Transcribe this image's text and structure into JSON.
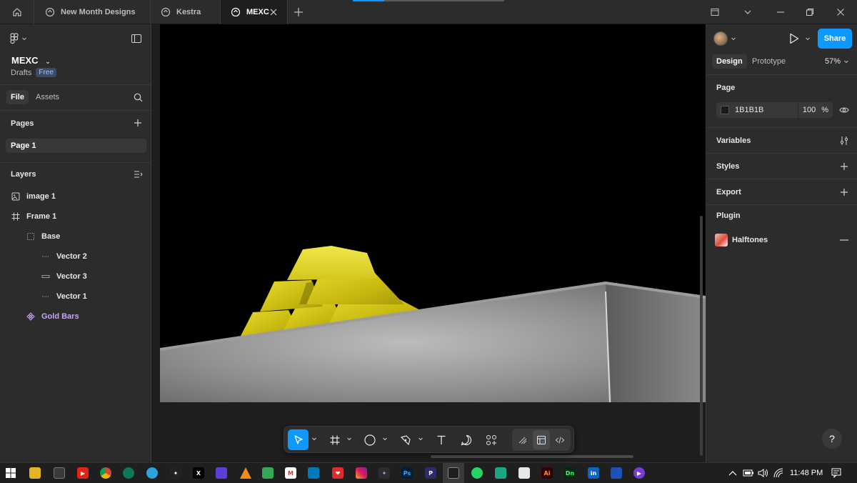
{
  "tabs": [
    {
      "label": "New Month Designs"
    },
    {
      "label": "Kestra"
    },
    {
      "label": "MEXC"
    }
  ],
  "project": {
    "name": "MEXC",
    "location": "Drafts",
    "plan_badge": "Free"
  },
  "left_tabs": {
    "file": "File",
    "assets": "Assets"
  },
  "pages": {
    "title": "Pages",
    "items": [
      "Page 1"
    ]
  },
  "layers": {
    "title": "Layers",
    "items": [
      {
        "label": "image 1",
        "icon": "image-icon"
      },
      {
        "label": "Frame 1",
        "icon": "frame-icon"
      },
      {
        "label": "Base",
        "icon": "group-icon"
      },
      {
        "label": "Vector 2",
        "icon": "vector-icon"
      },
      {
        "label": "Vector 3",
        "icon": "vector-icon"
      },
      {
        "label": "Vector 1",
        "icon": "vector-icon"
      },
      {
        "label": "Gold Bars",
        "icon": "component-icon"
      }
    ]
  },
  "right_panel": {
    "share_label": "Share",
    "tabs": {
      "design": "Design",
      "prototype": "Prototype"
    },
    "zoom": "57%",
    "page_section": {
      "title": "Page",
      "fill_hex": "1B1B1B",
      "opacity": "100",
      "opacity_unit": "%"
    },
    "variables": "Variables",
    "styles": "Styles",
    "export": "Export",
    "plugin": {
      "title": "Plugin",
      "name": "Halftones"
    }
  },
  "help": "?",
  "taskbar": {
    "time": "11:48 PM"
  },
  "colors": {
    "accent": "#0d99ff",
    "component": "#c7a2ff",
    "page_fill": "#1B1B1B"
  }
}
